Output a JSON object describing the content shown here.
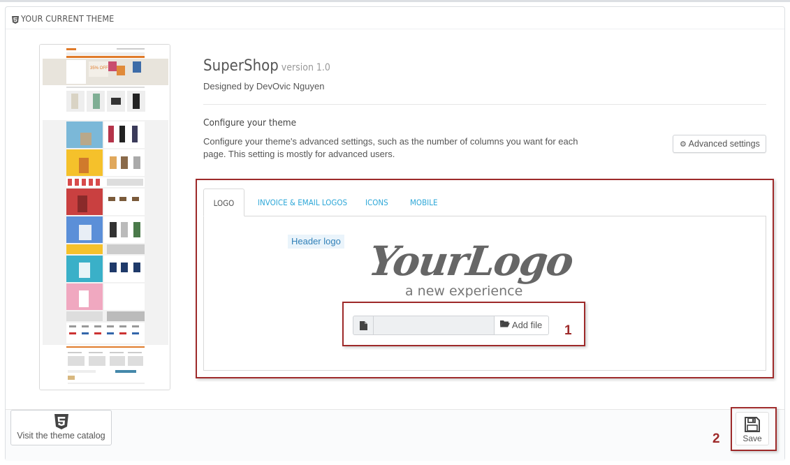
{
  "header": {
    "title": "YOUR CURRENT THEME",
    "icon": "html5-icon"
  },
  "theme": {
    "name": "SuperShop",
    "version": "version 1.0",
    "designer": "Designed by DevOvic Nguyen"
  },
  "configure": {
    "title": "Configure your theme",
    "description": "Configure your theme's advanced settings, such as the number of columns you want for each page. This setting is mostly for advanced users.",
    "advanced_button": "Advanced settings"
  },
  "tabs": [
    {
      "label": "LOGO",
      "active": true
    },
    {
      "label": "INVOICE & EMAIL LOGOS",
      "active": false
    },
    {
      "label": "ICONS",
      "active": false
    },
    {
      "label": "MOBILE",
      "active": false
    }
  ],
  "logo_tab": {
    "header_logo_label": "Header logo",
    "logo_text_main": "YourLogo",
    "logo_text_sub": "a new experience",
    "add_file_label": "Add file",
    "file_value": ""
  },
  "thumbnail_text": {
    "promo": "35% OFF"
  },
  "annotations": {
    "one": "1",
    "two": "2"
  },
  "footer": {
    "catalog_button": "Visit the theme catalog",
    "save_button": "Save"
  },
  "colors": {
    "accent_link": "#2fa8d8",
    "annotation_red": "#9e2a2a",
    "label_bg": "#eaf4fb"
  }
}
